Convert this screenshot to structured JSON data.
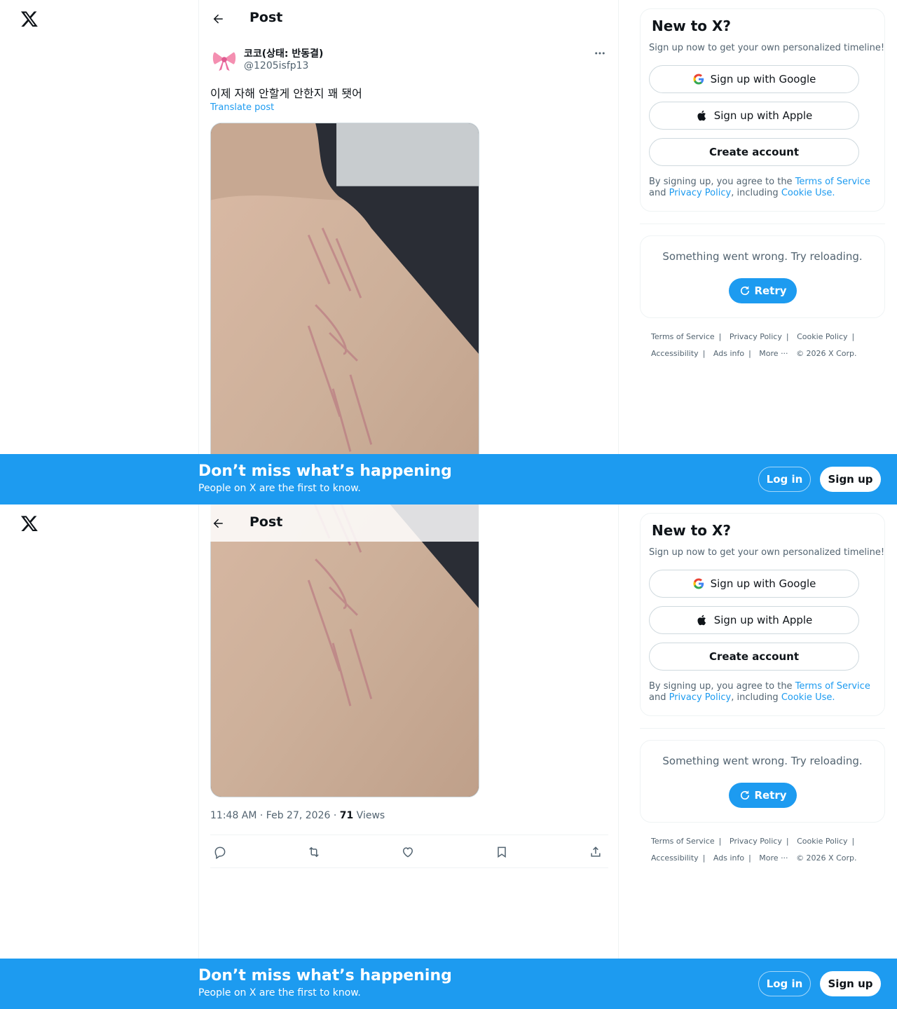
{
  "header": {
    "title": "Post"
  },
  "author": {
    "display_name": "코코(상태: 반동결)",
    "handle": "@1205isfp13"
  },
  "tweet": {
    "text": "이제 자해 안할게 안한지 꽤 됏어",
    "translate_label": "Translate post",
    "time": "11:48 AM · Feb 27, 2026 · ",
    "views_count": "71",
    "views_label": " Views"
  },
  "actions": [
    "reply-icon",
    "repost-icon",
    "like-icon",
    "bookmark-icon",
    "share-icon"
  ],
  "signup_card": {
    "title": "New to X?",
    "subtitle": "Sign up now to get your own personalized timeline!",
    "google_label": "Sign up with Google",
    "apple_label": "Sign up with Apple",
    "create_label": "Create account",
    "legal_prefix": "By signing up, you agree to the ",
    "terms_link": "Terms of Service",
    "legal_and": " and ",
    "privacy_link": "Privacy Policy",
    "legal_including": ", including ",
    "cookie_link": "Cookie Use."
  },
  "error_card": {
    "message": "Something went wrong. Try reloading.",
    "retry_label": "Retry"
  },
  "footer": {
    "terms": "Terms of Service",
    "privacy": "Privacy Policy",
    "cookie": "Cookie Policy",
    "accessibility": "Accessibility",
    "ads": "Ads info",
    "more": "More ···",
    "copyright": "© 2026 X Corp."
  },
  "banner": {
    "title": "Don’t miss what’s happening",
    "subtitle": "People on X are the first to know.",
    "login_label": "Log in",
    "signup_label": "Sign up"
  },
  "colors": {
    "accent": "#1d9bf0",
    "text": "#0f1419",
    "muted": "#536471",
    "border": "#eff3f4"
  }
}
